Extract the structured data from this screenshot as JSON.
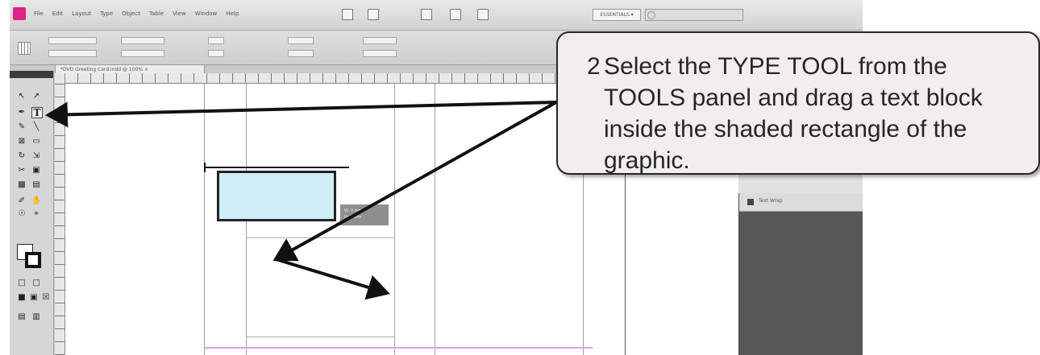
{
  "menubar": {
    "items": [
      "File",
      "Edit",
      "Layout",
      "Type",
      "Object",
      "Table",
      "View",
      "Window",
      "Help"
    ],
    "workspace": "ESSENTIALS ▾"
  },
  "document": {
    "tab_title": "*DVD Greeting Card.indd @ 100% ×"
  },
  "tools": {
    "type_tool_glyph": "T"
  },
  "tooltip": {
    "lines": [
      "W: 0 mm",
      "H: 0 mm"
    ]
  },
  "right_panel": {
    "item_label": "Text Wrap"
  },
  "callout": {
    "number": "2",
    "text": "Select the TYPE TOOL from the TOOLS panel and drag a text block inside the shaded rectangle of the graphic."
  },
  "colors": {
    "callout_bg": "#f1eeec",
    "shaded_fill": "#cdeef7",
    "arrow": "#111111",
    "app_logo": "#e0218a"
  }
}
